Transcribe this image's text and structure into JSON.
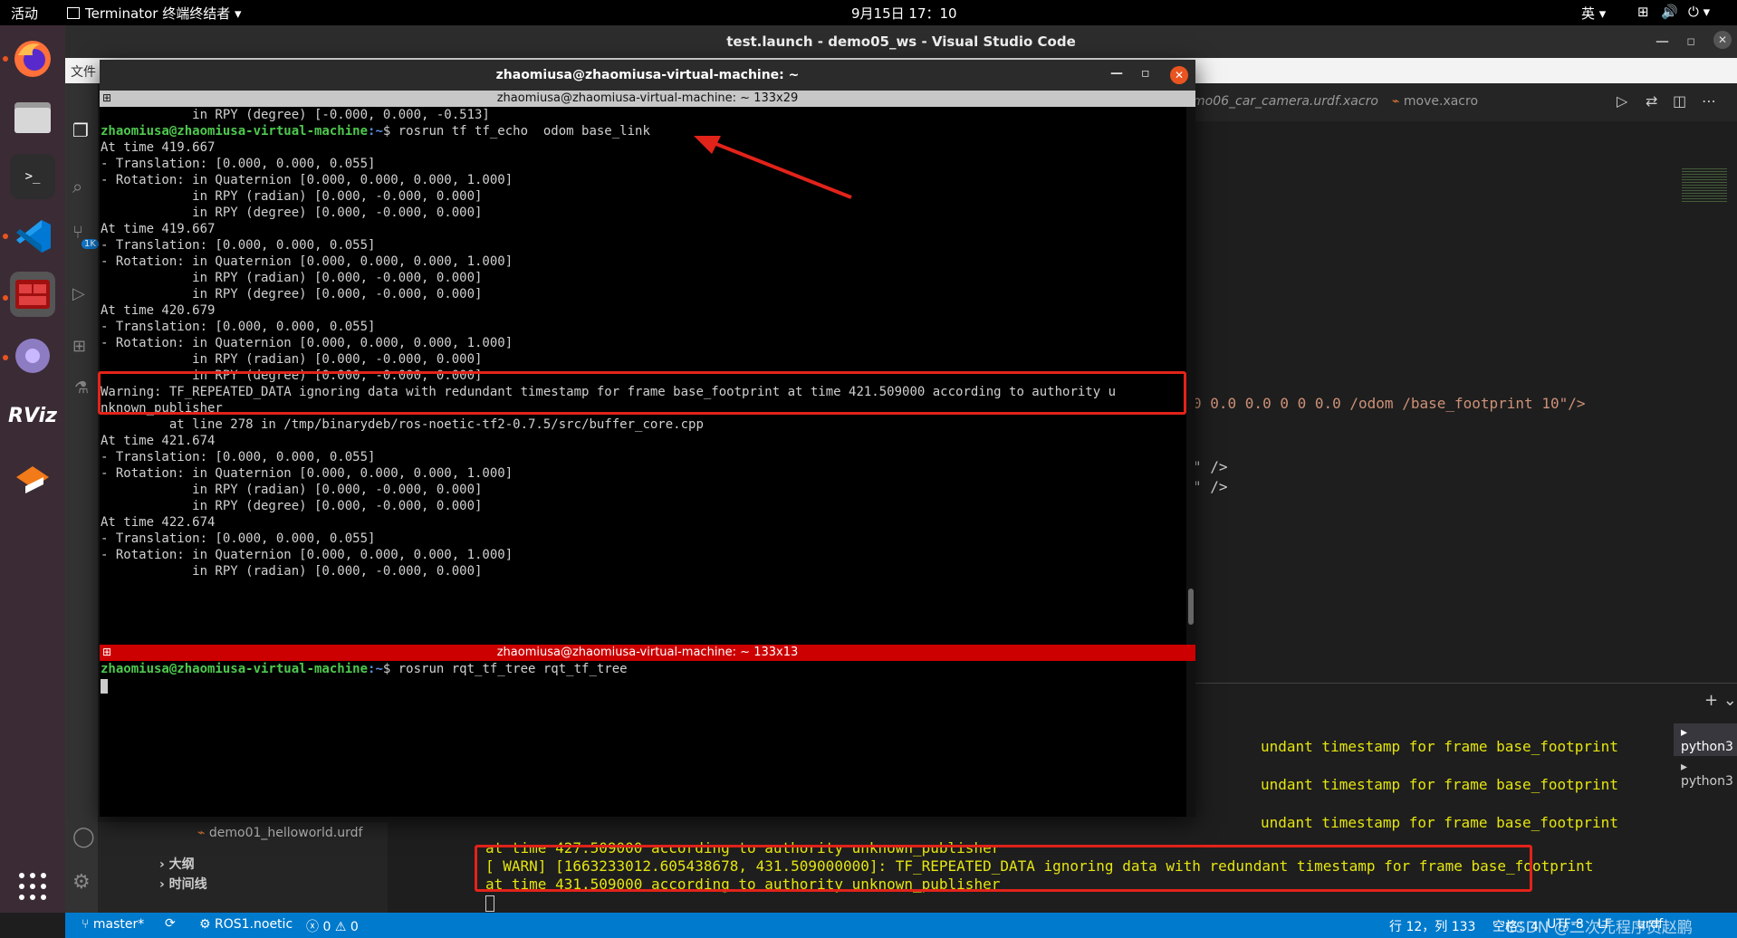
{
  "topbar": {
    "activities": "活动",
    "app_menu": "Terminator 终端终结者",
    "clock": "9月15日  17：10",
    "input_method": "英"
  },
  "dock": {
    "items": [
      "firefox-icon",
      "files-icon",
      "terminal-icon",
      "vscode-icon",
      "terminator-icon",
      "app-icon",
      "rviz-icon",
      "ubuntu-software-icon"
    ]
  },
  "vscode": {
    "title": "test.launch - demo05_ws - Visual Studio Code",
    "menu_file": "文件",
    "badge": "1K",
    "tabs": [
      "mo06_car_camera.urdf.xacro",
      "move.xacro"
    ],
    "editor_lines": [
      "0 0.0 0.0 0 0 0.0 /odom /base_footprint 10\"/>",
      "\" />",
      "\" />"
    ],
    "panel_terminals": [
      "python3",
      "python3"
    ],
    "panel_lines": [
      "undant timestamp for frame base_footprint",
      "undant timestamp for frame base_footprint",
      "undant timestamp for frame base_footprint",
      "at time 427.509000 according to authority unknown_publisher",
      "[ WARN] [1663233012.605438678, 431.509000000]: TF_REPEATED_DATA ignoring data with redundant timestamp for frame base_footprint",
      "at time 431.509000 according to authority unknown_publisher"
    ],
    "explorer": {
      "file": "demo01_helloworld.urdf",
      "outline": "大纲",
      "timeline": "时间线"
    },
    "status": {
      "branch": "master*",
      "ros": "ROS1.noetic",
      "problems": "0",
      "warnings": "0",
      "cursor": "行 12，列 133",
      "spaces": "空格：4",
      "encoding": "UTF-8",
      "eol": "LF",
      "lang": "urdf",
      "watermark": "CSDN @二次元程序员赵鹏"
    }
  },
  "terminator": {
    "window_title": "zhaomiusa@zhaomiusa-virtual-machine: ~",
    "pane1_title": "zhaomiusa@zhaomiusa-virtual-machine: ~ 133x29",
    "pane2_title": "zhaomiusa@zhaomiusa-virtual-machine: ~ 133x13",
    "prompt_user": "zhaomiusa@zhaomiusa-virtual-machine",
    "prompt_path": ":~",
    "pane1_lines": [
      {
        "text": "            in RPY (degree) [-0.000, 0.000, -0.513]"
      },
      {
        "cmd": "$ rosrun tf tf_echo  odom base_link"
      },
      {
        "text": "At time 419.667"
      },
      {
        "text": "- Translation: [0.000, 0.000, 0.055]"
      },
      {
        "text": "- Rotation: in Quaternion [0.000, 0.000, 0.000, 1.000]"
      },
      {
        "text": "            in RPY (radian) [0.000, -0.000, 0.000]"
      },
      {
        "text": "            in RPY (degree) [0.000, -0.000, 0.000]"
      },
      {
        "text": "At time 419.667"
      },
      {
        "text": "- Translation: [0.000, 0.000, 0.055]"
      },
      {
        "text": "- Rotation: in Quaternion [0.000, 0.000, 0.000, 1.000]"
      },
      {
        "text": "            in RPY (radian) [0.000, -0.000, 0.000]"
      },
      {
        "text": "            in RPY (degree) [0.000, -0.000, 0.000]"
      },
      {
        "text": "At time 420.679"
      },
      {
        "text": "- Translation: [0.000, 0.000, 0.055]"
      },
      {
        "text": "- Rotation: in Quaternion [0.000, 0.000, 0.000, 1.000]"
      },
      {
        "text": "            in RPY (radian) [0.000, -0.000, 0.000]"
      },
      {
        "text": "            in RPY (degree) [0.000, -0.000, 0.000]"
      },
      {
        "text": "Warning: TF_REPEATED_DATA ignoring data with redundant timestamp for frame base_footprint at time 421.509000 according to authority u"
      },
      {
        "text": "nknown_publisher"
      },
      {
        "text": "         at line 278 in /tmp/binarydeb/ros-noetic-tf2-0.7.5/src/buffer_core.cpp"
      },
      {
        "text": "At time 421.674"
      },
      {
        "text": "- Translation: [0.000, 0.000, 0.055]"
      },
      {
        "text": "- Rotation: in Quaternion [0.000, 0.000, 0.000, 1.000]"
      },
      {
        "text": "            in RPY (radian) [0.000, -0.000, 0.000]"
      },
      {
        "text": "            in RPY (degree) [0.000, -0.000, 0.000]"
      },
      {
        "text": "At time 422.674"
      },
      {
        "text": "- Translation: [0.000, 0.000, 0.055]"
      },
      {
        "text": "- Rotation: in Quaternion [0.000, 0.000, 0.000, 1.000]"
      },
      {
        "text": "            in RPY (radian) [0.000, -0.000, 0.000]"
      }
    ],
    "pane2_command": "$ rosrun rqt_tf_tree rqt_tf_tree",
    "annotation_color": "#e2231a"
  }
}
